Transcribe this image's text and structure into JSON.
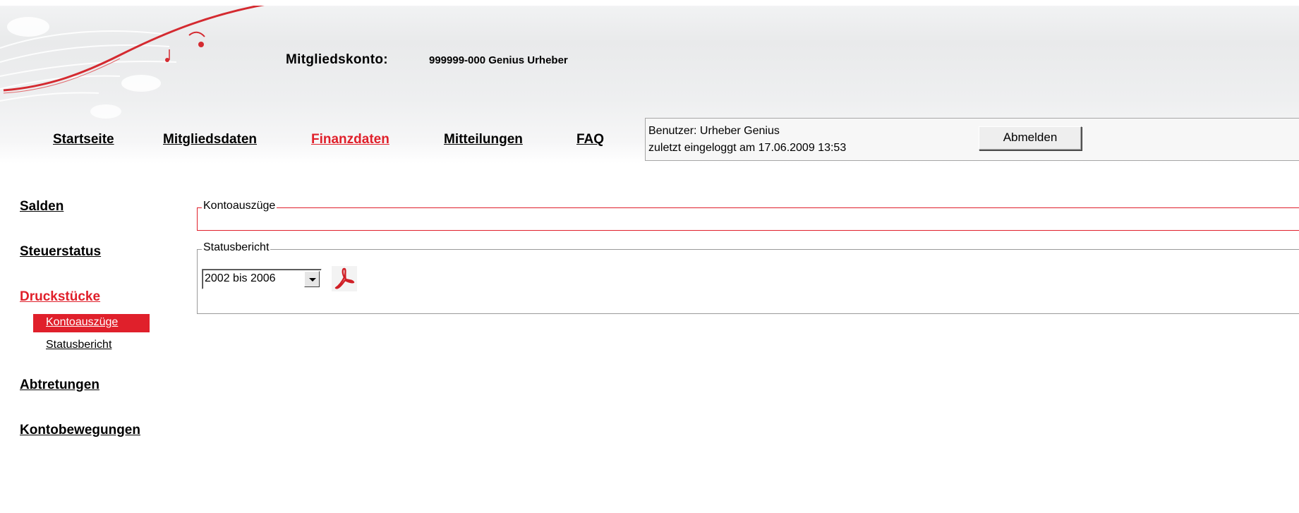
{
  "header": {
    "account_label": "Mitgliedskonto:",
    "account_value": "999999-000 Genius Urheber"
  },
  "main_nav": [
    {
      "label": "Startseite",
      "active": false
    },
    {
      "label": "Mitgliedsdaten",
      "active": false
    },
    {
      "label": "Finanzdaten",
      "active": true
    },
    {
      "label": "Mitteilungen",
      "active": false
    },
    {
      "label": "FAQ",
      "active": false
    }
  ],
  "user_box": {
    "user_line": "Benutzer: Urheber Genius",
    "last_login_line": "zuletzt eingeloggt am 17.06.2009 13:53",
    "logout_label": "Abmelden"
  },
  "side_nav": {
    "items": [
      {
        "label": "Salden",
        "active": false
      },
      {
        "label": "Steuerstatus",
        "active": false
      },
      {
        "label": "Druckstücke",
        "active": true
      },
      {
        "label": "Abtretungen",
        "active": false
      },
      {
        "label": "Kontobewegungen",
        "active": false
      }
    ],
    "sub_items": [
      {
        "label": "Kontoauszüge",
        "active": true
      },
      {
        "label": "Statusbericht",
        "active": false
      }
    ]
  },
  "content": {
    "kontoauszuege_legend": "Kontoauszüge",
    "statusbericht_legend": "Statusbericht",
    "year_select_value": "2002 bis 2006",
    "pdf_icon": "pdf-icon"
  },
  "colors": {
    "accent": "#e0202b",
    "text": "#000000",
    "border_gray": "#9a9a9a"
  }
}
